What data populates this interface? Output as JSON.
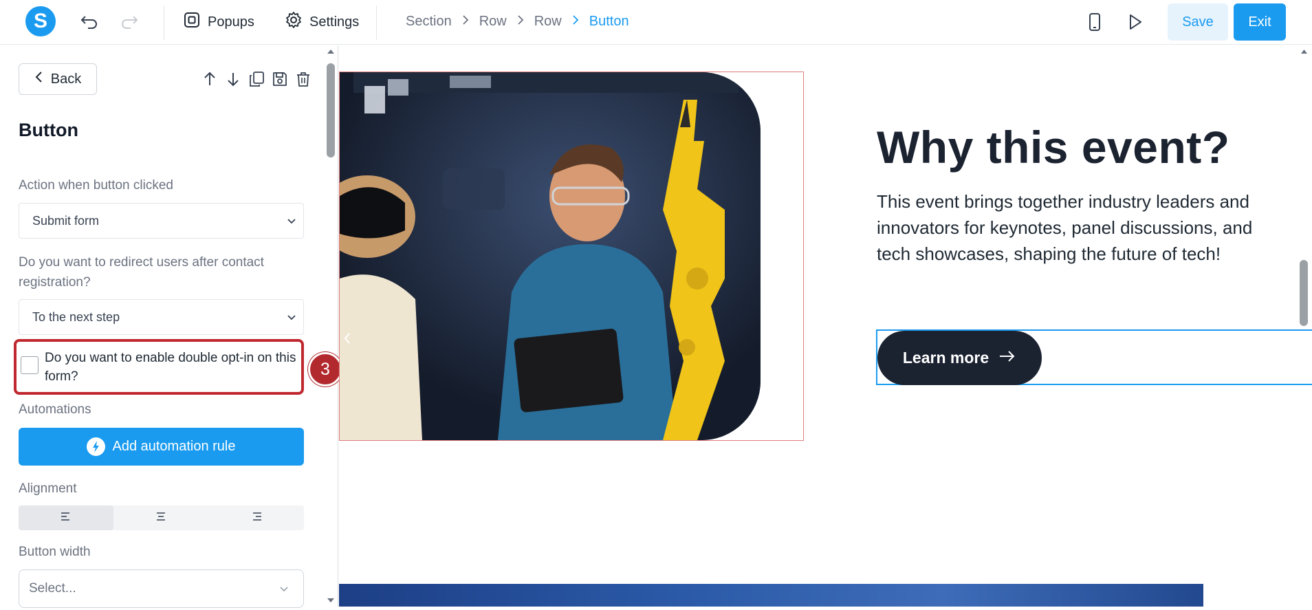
{
  "topbar": {
    "logo_letter": "S",
    "popups_label": "Popups",
    "settings_label": "Settings",
    "breadcrumb": [
      "Section",
      "Row",
      "Row",
      "Button"
    ],
    "save_label": "Save",
    "exit_label": "Exit"
  },
  "sidebar": {
    "back_label": "Back",
    "title": "Button",
    "action_label": "Action when button clicked",
    "action_value": "Submit form",
    "redirect_label": "Do you want to redirect users after contact registration?",
    "redirect_value": "To the next step",
    "optin_label": "Do you want to enable double opt-in on this form?",
    "optin_checked": false,
    "step_badge": "3",
    "automations_label": "Automations",
    "add_automation_label": "Add automation rule",
    "alignment_label": "Alignment",
    "alignment_selected": "left",
    "button_width_label": "Button width",
    "button_width_placeholder": "Select..."
  },
  "canvas": {
    "heading": "Why this event?",
    "paragraph": "This event brings together industry leaders and innovators for keynotes, panel discussions, and tech showcases, shaping the future of tech!",
    "cta_label": "Learn more"
  },
  "colors": {
    "accent": "#1a9bf0",
    "highlight": "#c0282f",
    "dark": "#1b2230"
  }
}
